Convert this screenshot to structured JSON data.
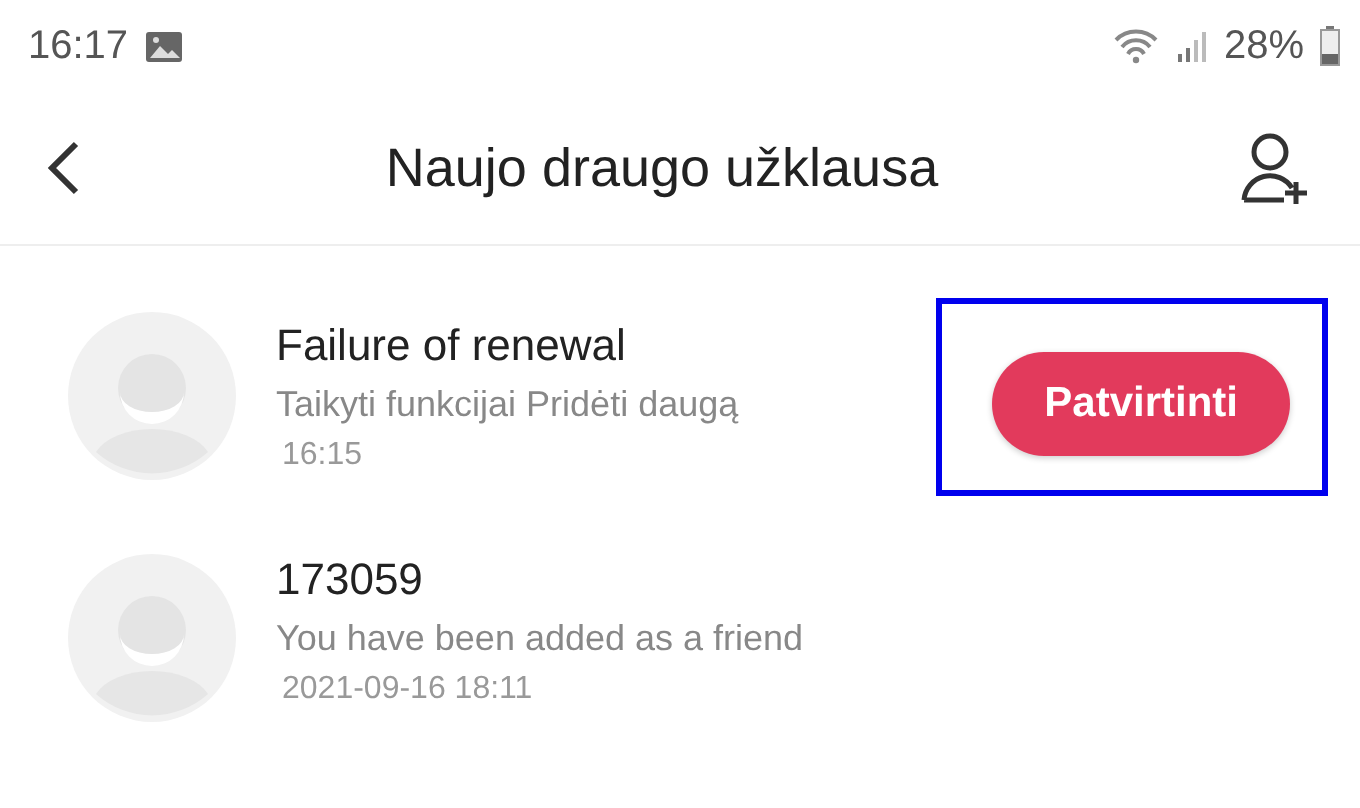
{
  "status_bar": {
    "time": "16:17",
    "battery": "28%"
  },
  "header": {
    "title": "Naujo draugo užklausa"
  },
  "requests": [
    {
      "name": "Failure of renewal",
      "message": "Taikyti funkcijai Pridėti daugą",
      "time": "16:15",
      "action": {
        "label": "Patvirtinti",
        "highlighted": true
      }
    },
    {
      "name": "173059",
      "message": "You have been added as a friend",
      "time": "2021-09-16 18:11"
    }
  ]
}
